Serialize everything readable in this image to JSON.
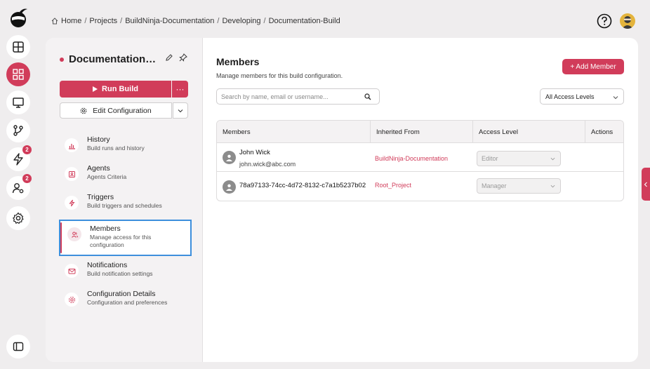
{
  "breadcrumb": {
    "home": "Home",
    "items": [
      "Projects",
      "BuildNinja-Documentation",
      "Developing",
      "Documentation-Build"
    ]
  },
  "rail": {
    "badges": {
      "builds": "2",
      "users": "2"
    }
  },
  "config": {
    "title": "Documentation-Bu...",
    "run_label": "Run Build",
    "more_label": "···",
    "edit_label": "Edit Configuration"
  },
  "nav": [
    {
      "title": "History",
      "sub": "Build runs and history",
      "icon": "bar-chart-icon"
    },
    {
      "title": "Agents",
      "sub": "Agents Criteria",
      "icon": "agent-icon"
    },
    {
      "title": "Triggers",
      "sub": "Build triggers and schedules",
      "icon": "bolt-icon"
    },
    {
      "title": "Members",
      "sub": "Manage access for this configuration",
      "icon": "members-icon"
    },
    {
      "title": "Notifications",
      "sub": "Build notification settings",
      "icon": "mail-icon"
    },
    {
      "title": "Configuration Details",
      "sub": "Configuration and preferences",
      "icon": "gear-icon"
    }
  ],
  "members": {
    "title": "Members",
    "subtitle": "Manage members for this build configuration.",
    "add_label": "+ Add Member",
    "search_placeholder": "Search by name, email or username...",
    "filter_value": "All Access Levels",
    "columns": [
      "Members",
      "Inherited From",
      "Access Level",
      "Actions"
    ],
    "rows": [
      {
        "name": "John Wick",
        "email": "john.wick@abc.com",
        "inherited": "BuildNinja-Documentation",
        "level": "Editor"
      },
      {
        "name": "78a97133-74cc-4d72-8132-c7a1b5237b02",
        "email": "",
        "inherited": "Root_Project",
        "level": "Manager"
      }
    ]
  },
  "colors": {
    "accent": "#d13c5a",
    "highlight": "#3d8fdc"
  }
}
